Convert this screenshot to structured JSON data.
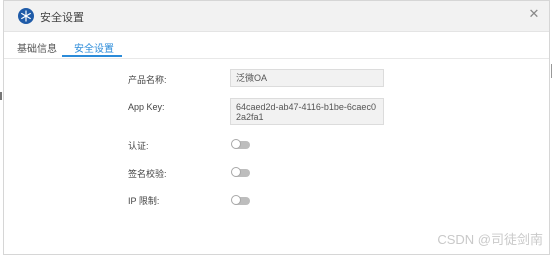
{
  "dialog": {
    "title": "安全设置",
    "app_icon": "snowflake-icon",
    "close_icon": "close-icon"
  },
  "tabs": [
    {
      "label": "基础信息"
    },
    {
      "label": "安全设置"
    }
  ],
  "form": {
    "product_name_label": "产品名称:",
    "product_name_value": "泛微OA",
    "app_key_label": "App Key:",
    "app_key_value": "64caed2d-ab47-4116-b1be-6caec02a2fa1",
    "auth_label": "认证:",
    "signature_label": "签名校验:",
    "ip_label": "IP 限制:",
    "auth_enabled": false,
    "signature_enabled": false,
    "ip_enabled": false
  },
  "watermark": "CSDN @司徒剑南",
  "colors": {
    "accent": "#2b8bd9",
    "icon_bg": "#1f5ba8"
  }
}
